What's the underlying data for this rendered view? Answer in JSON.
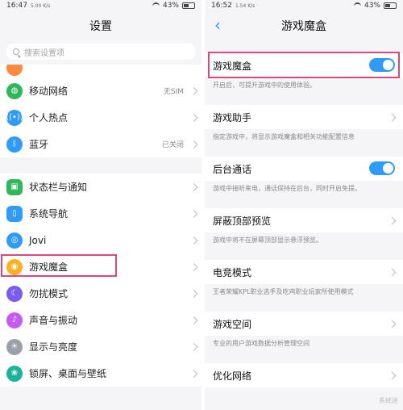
{
  "left": {
    "status": {
      "time": "16:47",
      "signal": "5.00 K/s",
      "battery": "43%"
    },
    "title": "设置",
    "search": {
      "placeholder": "搜索设置项"
    },
    "items": [
      {
        "label": "移动网络",
        "value": "无SIM",
        "color": "#2fb85a",
        "icon": "globe"
      },
      {
        "label": "个人热点",
        "value": "",
        "color": "#2f9bff",
        "icon": "hotspot"
      },
      {
        "label": "蓝牙",
        "value": "已关闭",
        "color": "#2f9bff",
        "icon": "bluetooth"
      },
      {
        "label": "状态栏与通知",
        "value": "",
        "color": "#2fb85a",
        "icon": "status-bar"
      },
      {
        "label": "系统导航",
        "value": "",
        "color": "#2f9bff",
        "icon": "navigation"
      },
      {
        "label": "Jovi",
        "value": "",
        "color": "#2f9bff",
        "icon": "jovi"
      },
      {
        "label": "游戏魔盒",
        "value": "",
        "color": "#ffb020",
        "icon": "game"
      },
      {
        "label": "勿扰模式",
        "value": "",
        "color": "#7a5cf0",
        "icon": "moon"
      },
      {
        "label": "声音与振动",
        "value": "",
        "color": "#c65bf0",
        "icon": "sound"
      },
      {
        "label": "显示与亮度",
        "value": "",
        "color": "#9aa0a6",
        "icon": "brightness"
      },
      {
        "label": "锁屏、桌面与壁纸",
        "value": "",
        "color": "#1bb39a",
        "icon": "wallpaper"
      }
    ]
  },
  "right": {
    "status": {
      "time": "16:52",
      "signal": "1.54 K/s",
      "battery": "43%"
    },
    "title": "游戏魔盒",
    "items": [
      {
        "title": "游戏魔盒",
        "desc": "开启后，可提升游戏中的使用体验。",
        "toggle": true
      },
      {
        "title": "游戏助手",
        "desc": "指定游戏中，将显示游戏魔盒和相关功能配置信息",
        "toggle": false
      },
      {
        "title": "后台通话",
        "desc": "游戏中接听来电，通话保持在后台，同时开启免提。",
        "toggle": true
      },
      {
        "title": "屏蔽顶部预览",
        "desc": "游戏中将不在屏幕顶部显示悬浮预览。",
        "toggle": false
      },
      {
        "title": "电竞模式",
        "desc": "王者荣耀KPL职业选手及吃鸡职业玩家所使用模式",
        "toggle": false
      },
      {
        "title": "游戏空间",
        "desc": "专业的用户游戏数据分析管理空间",
        "toggle": false
      },
      {
        "title": "优化网络",
        "desc": "",
        "toggle": false
      }
    ],
    "watermark": "系统迷"
  }
}
